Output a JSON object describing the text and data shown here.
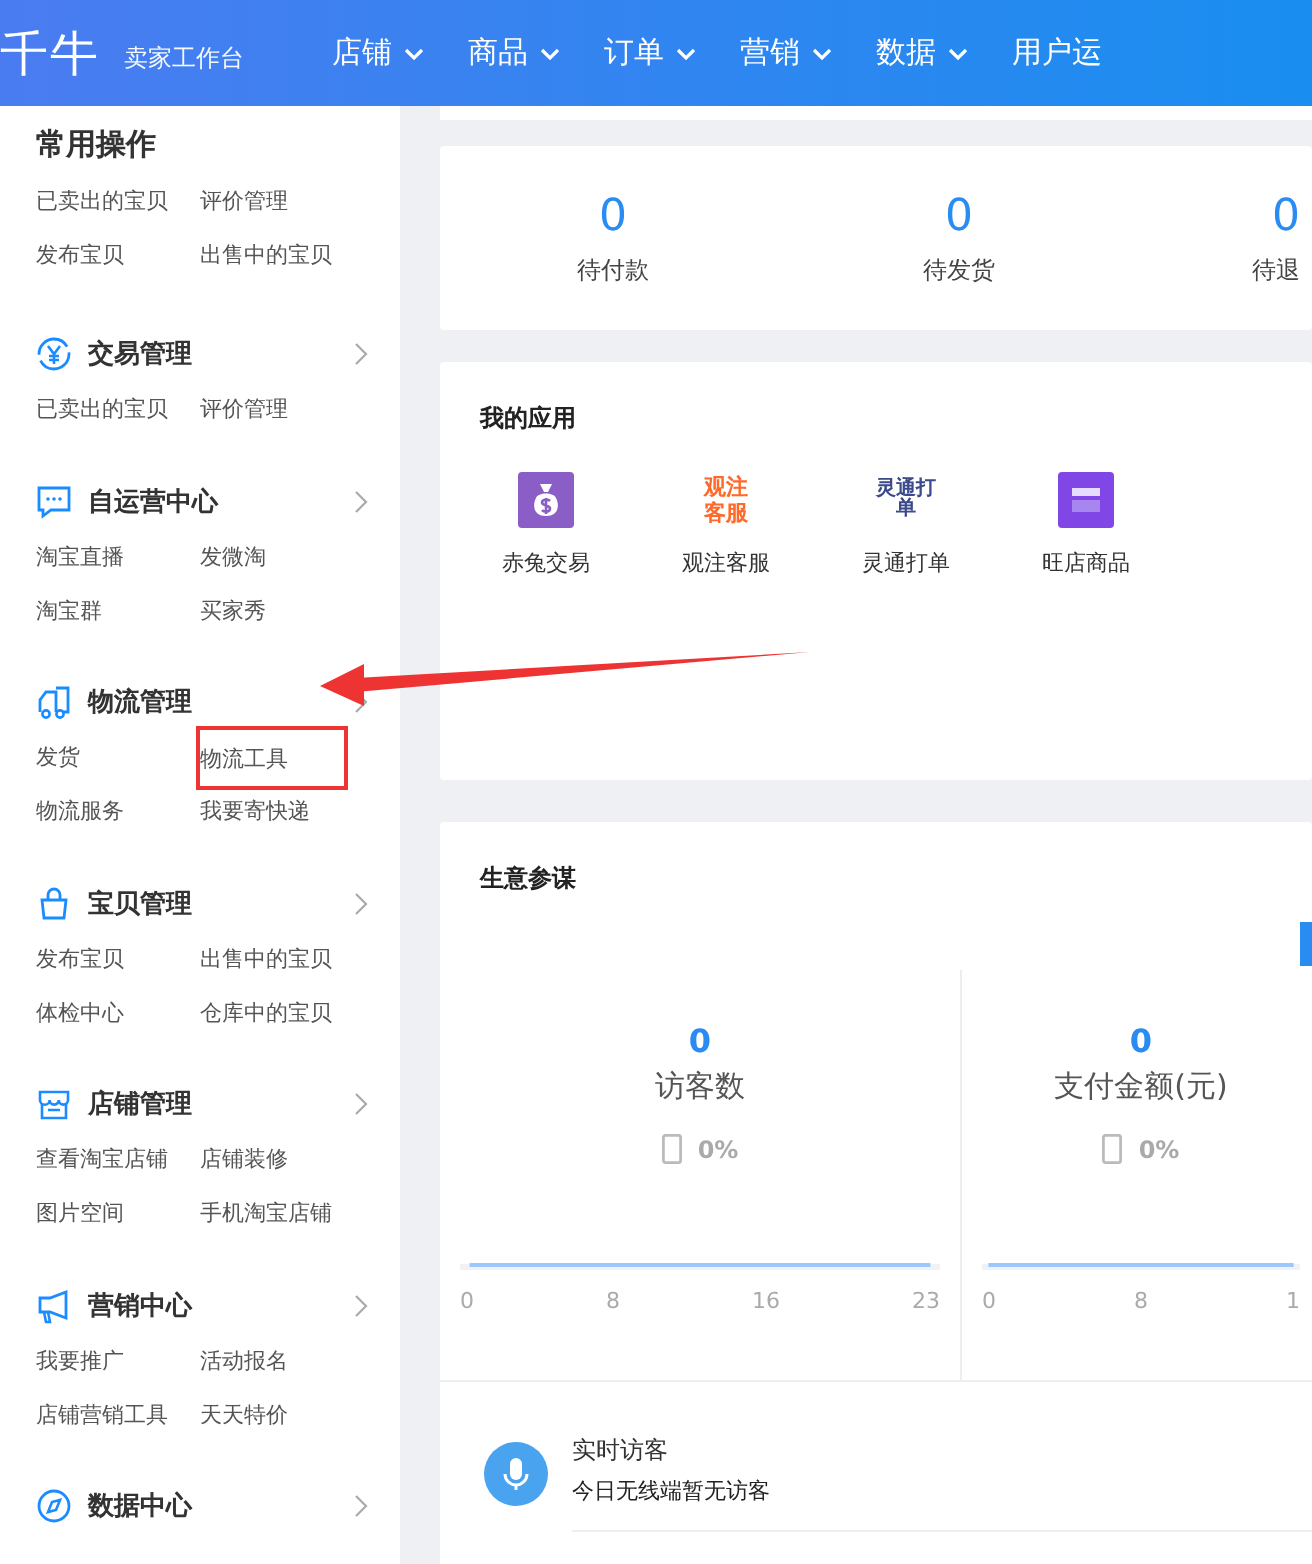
{
  "header": {
    "logo": "千牛",
    "subtitle": "卖家工作台",
    "nav": [
      {
        "label": "店铺",
        "has_caret": true
      },
      {
        "label": "商品",
        "has_caret": true
      },
      {
        "label": "订单",
        "has_caret": true
      },
      {
        "label": "营销",
        "has_caret": true
      },
      {
        "label": "数据",
        "has_caret": true
      },
      {
        "label": "用户运",
        "has_caret": false
      }
    ]
  },
  "sidebar": {
    "common": {
      "title": "常用操作",
      "links": [
        {
          "label": "已卖出的宝贝",
          "highlighted": false
        },
        {
          "label": "评价管理",
          "highlighted": false
        },
        {
          "label": "发布宝贝",
          "highlighted": false
        },
        {
          "label": "出售中的宝贝",
          "highlighted": false
        }
      ]
    },
    "groups": [
      {
        "title": "交易管理",
        "links": [
          {
            "label": "已卖出的宝贝",
            "highlighted": false
          },
          {
            "label": "评价管理",
            "highlighted": false
          }
        ]
      },
      {
        "title": "自运营中心",
        "links": [
          {
            "label": "淘宝直播",
            "highlighted": false
          },
          {
            "label": "发微淘",
            "highlighted": false
          },
          {
            "label": "淘宝群",
            "highlighted": false
          },
          {
            "label": "买家秀",
            "highlighted": false
          }
        ]
      },
      {
        "title": "物流管理",
        "links": [
          {
            "label": "发货",
            "highlighted": false
          },
          {
            "label": "物流工具",
            "highlighted": true
          },
          {
            "label": "物流服务",
            "highlighted": false
          },
          {
            "label": "我要寄快递",
            "highlighted": false
          }
        ]
      },
      {
        "title": "宝贝管理",
        "links": [
          {
            "label": "发布宝贝",
            "highlighted": false
          },
          {
            "label": "出售中的宝贝",
            "highlighted": false
          },
          {
            "label": "体检中心",
            "highlighted": false
          },
          {
            "label": "仓库中的宝贝",
            "highlighted": false
          }
        ]
      },
      {
        "title": "店铺管理",
        "links": [
          {
            "label": "查看淘宝店铺",
            "highlighted": false
          },
          {
            "label": "店铺装修",
            "highlighted": false
          },
          {
            "label": "图片空间",
            "highlighted": false
          },
          {
            "label": "手机淘宝店铺",
            "highlighted": false
          }
        ]
      },
      {
        "title": "营销中心",
        "links": [
          {
            "label": "我要推广",
            "highlighted": false
          },
          {
            "label": "活动报名",
            "highlighted": false
          },
          {
            "label": "店铺营销工具",
            "highlighted": false
          },
          {
            "label": "天天特价",
            "highlighted": false
          }
        ]
      },
      {
        "title": "数据中心"
      }
    ]
  },
  "order_stats": [
    {
      "value": "0",
      "label": "待付款"
    },
    {
      "value": "0",
      "label": "待发货"
    },
    {
      "value": "0",
      "label": "待退"
    }
  ],
  "my_apps": {
    "title": "我的应用",
    "apps": [
      {
        "name": "赤兔交易"
      },
      {
        "name": "观注客服",
        "icon_text": "观注客服"
      },
      {
        "name": "灵通打单",
        "icon_text": "灵通打单"
      },
      {
        "name": "旺店商品"
      }
    ]
  },
  "business": {
    "title": "生意参谋",
    "metrics": [
      {
        "value": "0",
        "label": "访客数",
        "share": "0%",
        "x_labels": [
          "0",
          "8",
          "16",
          "23"
        ]
      },
      {
        "value": "0",
        "label": "支付金额(元)",
        "share": "0%",
        "x_labels": [
          "0",
          "8",
          "1"
        ]
      }
    ],
    "realtime": {
      "title": "实时访客",
      "message": "今日无线端暂无访客"
    }
  }
}
